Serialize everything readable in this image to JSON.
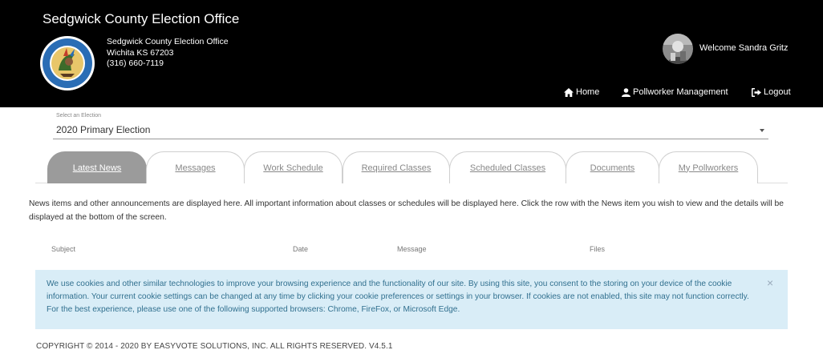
{
  "header": {
    "site_title": "Sedgwick County Election Office",
    "office_name": "Sedgwick County Election Office",
    "office_city": "Wichita KS 67203",
    "office_phone": "(316) 660-7119",
    "seal_text": "SEDGWICK COUNTY KANSAS",
    "welcome": "Welcome Sandra Gritz",
    "nav": [
      {
        "label": "Home",
        "icon": "home-icon"
      },
      {
        "label": "Pollworker Management",
        "icon": "user-icon"
      },
      {
        "label": "Logout",
        "icon": "logout-icon"
      }
    ],
    "colors": {
      "background": "#000000",
      "text": "#ffffff"
    }
  },
  "election_select": {
    "label": "Select an Election",
    "value": "2020 Primary Election"
  },
  "tabs": [
    {
      "label": "Latest News",
      "active": true
    },
    {
      "label": "Messages",
      "active": false
    },
    {
      "label": "Work Schedule",
      "active": false
    },
    {
      "label": "Required Classes",
      "active": false
    },
    {
      "label": "Scheduled Classes",
      "active": false
    },
    {
      "label": "Documents",
      "active": false
    },
    {
      "label": "My Pollworkers",
      "active": false
    }
  ],
  "news": {
    "intro": "News items and other announcements are displayed here. All important information about classes or schedules will be displayed here. Click the row with the News item you wish to view and the details will be displayed at the bottom of the screen.",
    "columns": [
      "Subject",
      "Date",
      "Message",
      "Files"
    ]
  },
  "cookie_notice": {
    "text": "We use cookies and other similar technologies to improve your browsing experience and the functionality of our site. By using this site, you consent to the storing on your device of the cookie information. Your current cookie settings can be changed at any time by clicking your cookie preferences or settings in your browser. If cookies are not enabled, this site may not function correctly. For the best experience, please use one of the following supported browsers: Chrome, FireFox, or Microsoft Edge.",
    "close": "×",
    "colors": {
      "background": "#d9edf7",
      "text": "#31708f"
    }
  },
  "footer": {
    "text": "COPYRIGHT © 2014 - 2020 BY EASYVOTE SOLUTIONS, INC. ALL RIGHTS RESERVED. V4.5.1"
  }
}
